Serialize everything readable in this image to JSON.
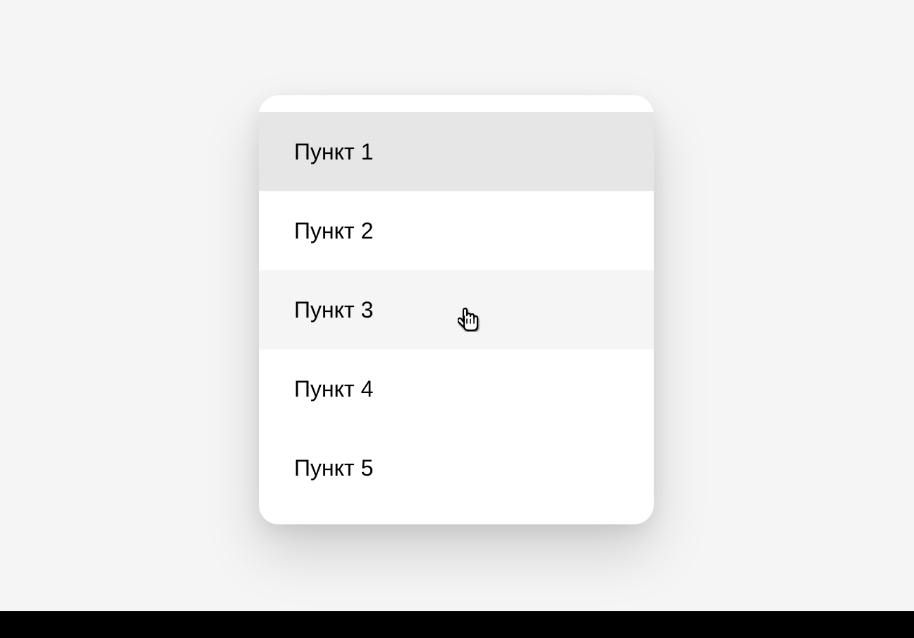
{
  "menu": {
    "items": [
      {
        "label": "Пункт 1",
        "state": "selected"
      },
      {
        "label": "Пункт 2",
        "state": "normal"
      },
      {
        "label": "Пункт 3",
        "state": "hovered"
      },
      {
        "label": "Пункт 4",
        "state": "normal"
      },
      {
        "label": "Пункт 5",
        "state": "normal"
      }
    ]
  }
}
